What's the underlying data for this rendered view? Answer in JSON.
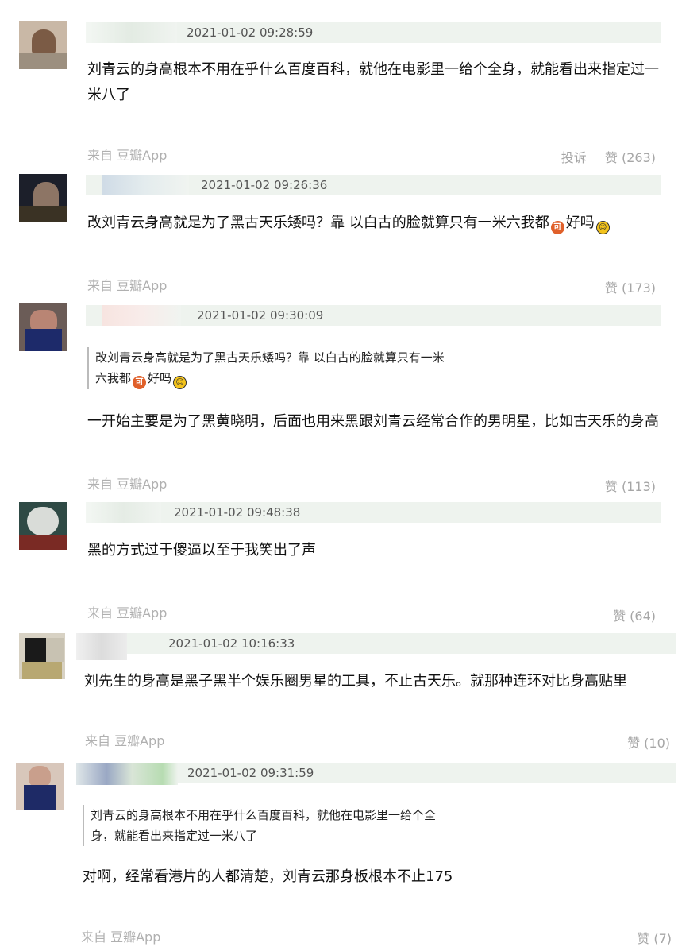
{
  "comments": [
    {
      "time": "2021-01-02 09:28:59",
      "text": "刘青云的身高根本不用在乎什么百度百科，就他在电影里一给个全身，就能看出来指定过一米八了",
      "source": "来自 豆瓣App",
      "report": "投诉",
      "likes": "赞 (263)"
    },
    {
      "time": "2021-01-02 09:26:36",
      "text_a": "改刘青云身高就是为了黑古天乐矮吗？靠 以白古的脸就算只有一米六我都",
      "text_b": "好吗",
      "source": "来自 豆瓣App",
      "likes": "赞 (173)"
    },
    {
      "time": "2021-01-02 09:30:09",
      "quote_line1": "改刘青云身高就是为了黑古天乐矮吗？靠 以白古的脸就算只有一米",
      "quote_line2a": "六我都",
      "quote_line2b": "好吗",
      "text": "一开始主要是为了黑黄晓明，后面也用来黑跟刘青云经常合作的男明星，比如古天乐的身高",
      "source": "来自 豆瓣App",
      "likes": "赞 (113)"
    },
    {
      "time": "2021-01-02 09:48:38",
      "text": "黑的方式过于傻逼以至于我笑出了声",
      "source": "来自 豆瓣App",
      "likes": "赞 (64)"
    },
    {
      "time": "2021-01-02 10:16:33",
      "text": "刘先生的身高是黑子黑半个娱乐圈男星的工具，不止古天乐。就那种连环对比身高贴里",
      "source": "来自 豆瓣App",
      "likes": "赞 (10)"
    },
    {
      "time": "2021-01-02 09:31:59",
      "quote_line1": "刘青云的身高根本不用在乎什么百度百科，就他在电影里一给个全",
      "quote_line2": "身，就能看出来指定过一米八了",
      "text": "对啊，经常看港片的人都清楚，刘青云那身板根本不止175",
      "source": "来自 豆瓣App",
      "likes": "赞 (7)"
    }
  ],
  "emoji": {
    "orange": "可",
    "yellow": "☺"
  },
  "colors": {
    "header_bar": "#eef3ee",
    "source_text": "#b0b0b0",
    "action_text": "#a6a6a6"
  }
}
